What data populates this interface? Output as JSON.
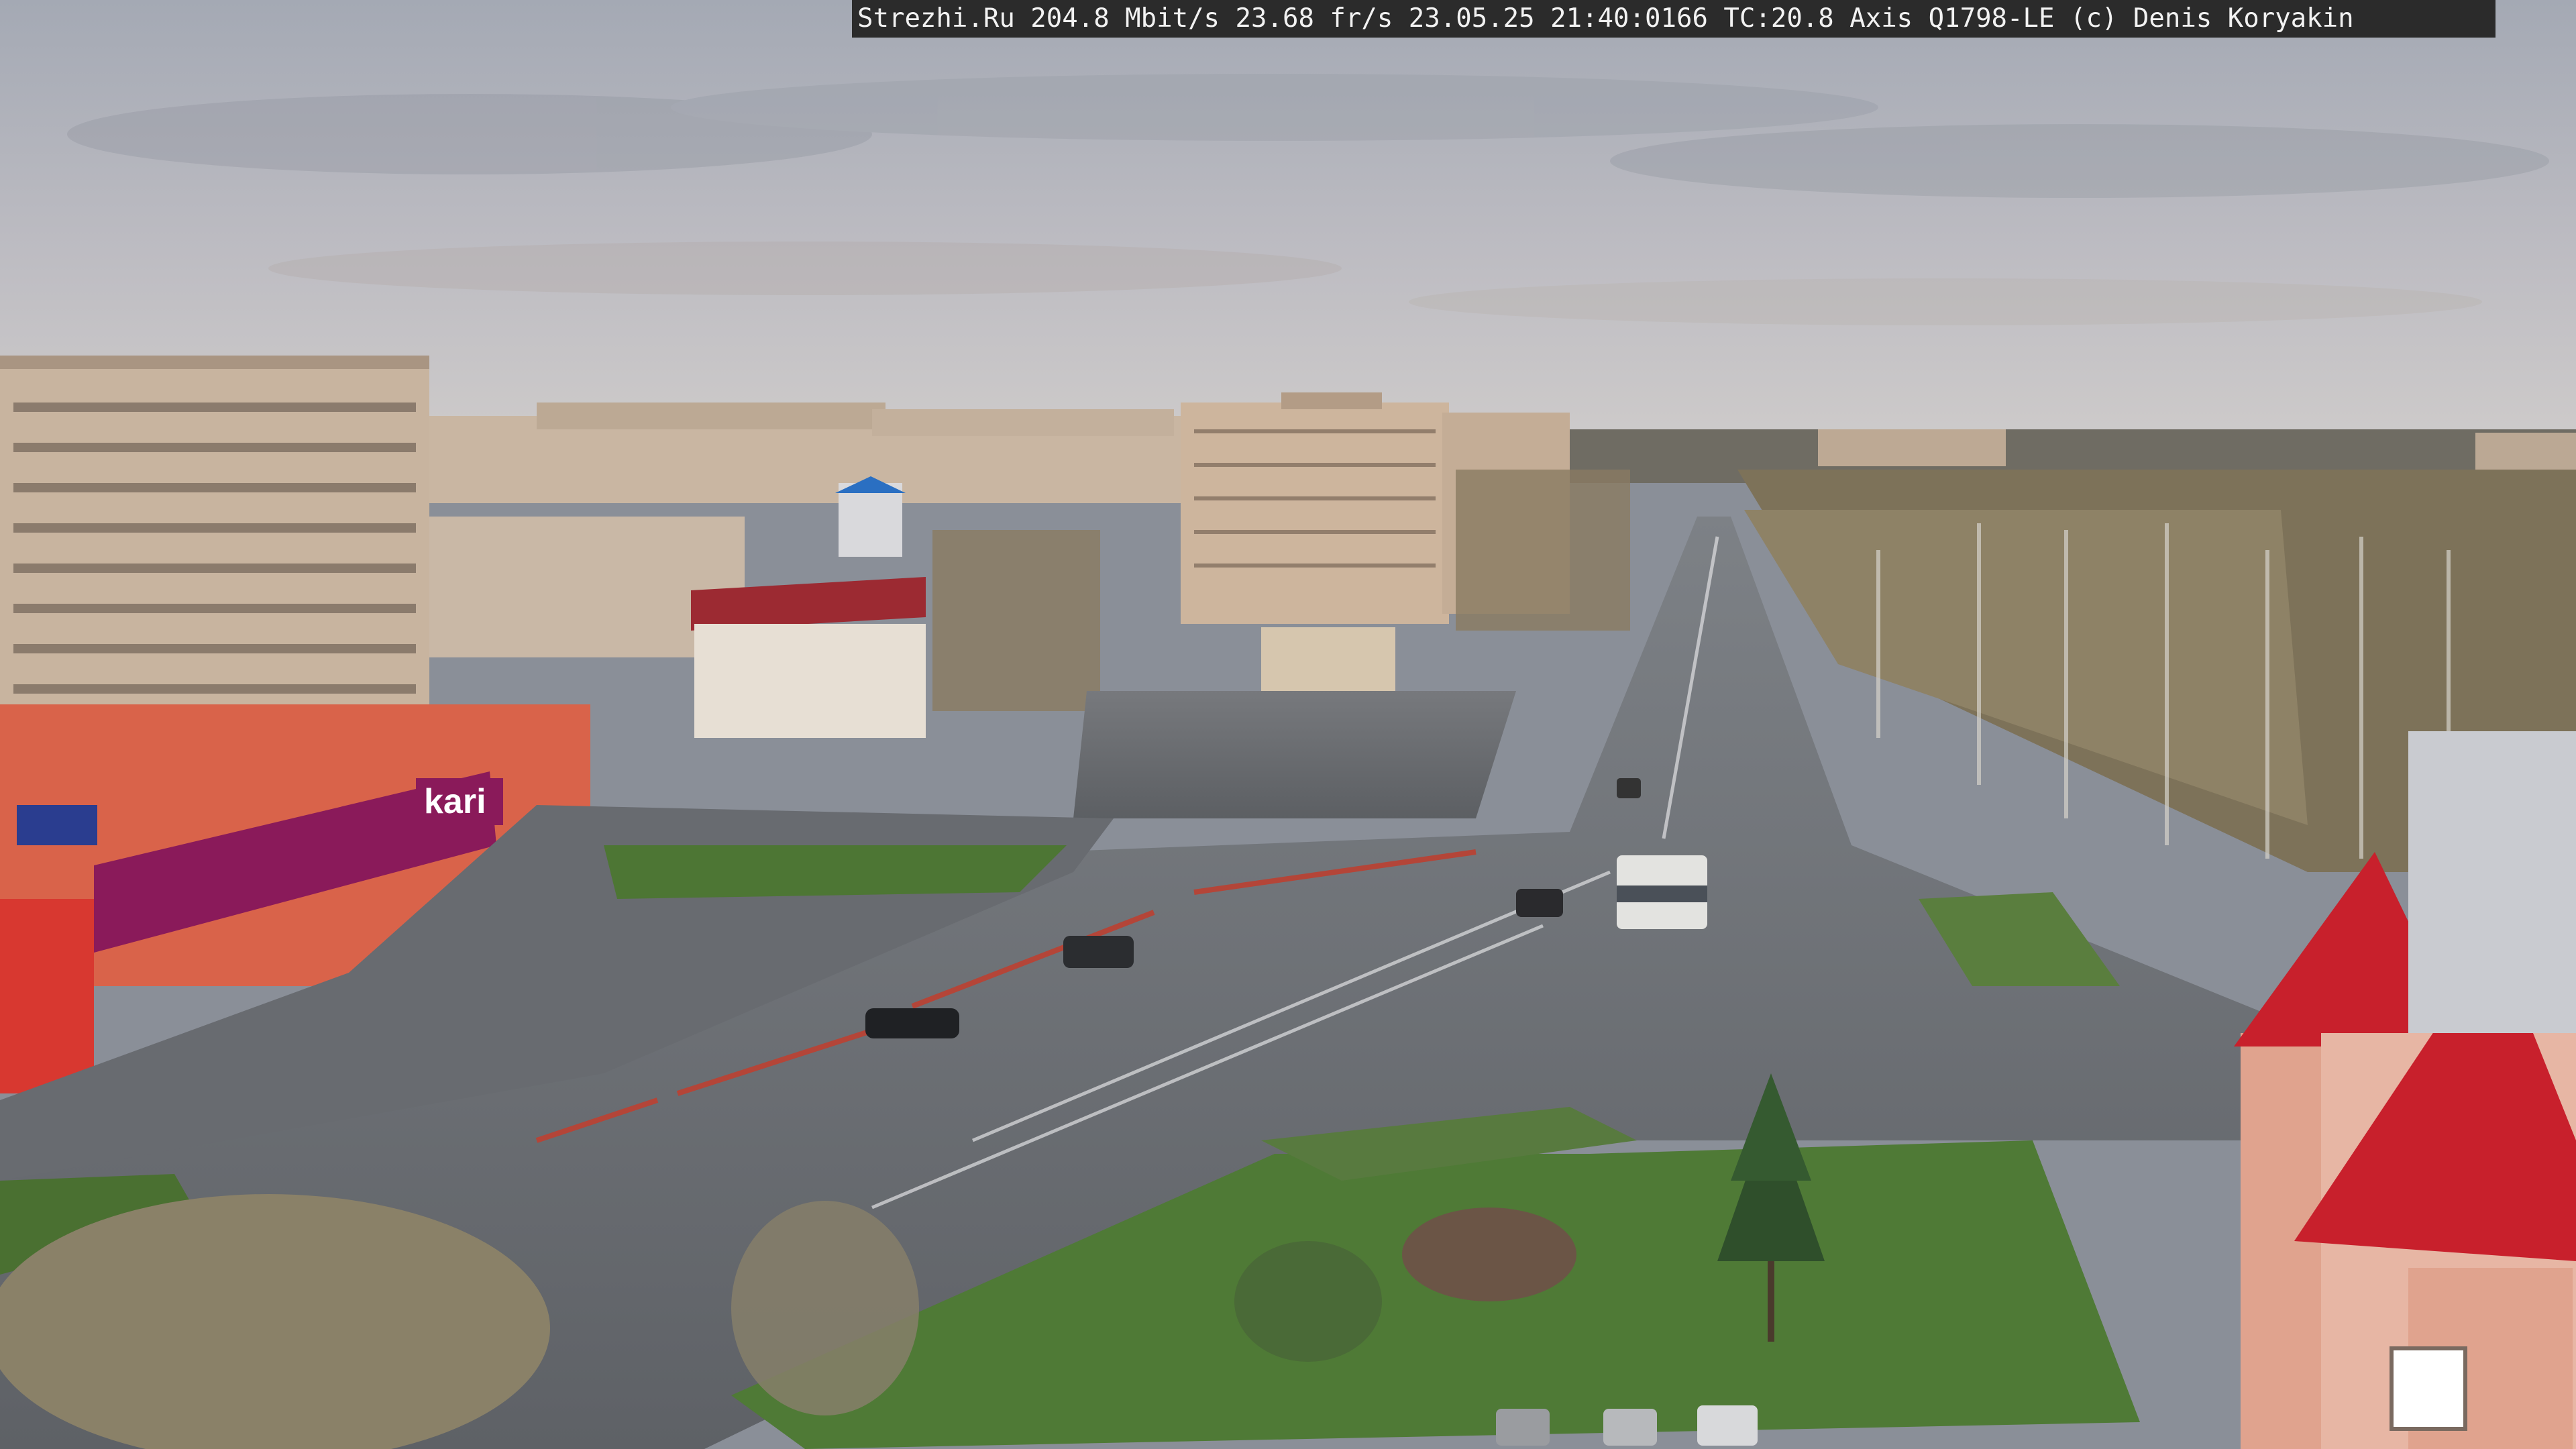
{
  "camera_overlay": {
    "text": "Strezhi.Ru 204.8 Mbit/s 23.68 fr/s 23.05.25 21:40:0166 TC:20.8  Axis Q1798-LE  (c) Denis Koryakin"
  },
  "storefront": {
    "brand": "kari"
  },
  "colors": {
    "sky_top": "#a9aeb8",
    "sky_bottom": "#c9c6c6",
    "asphalt": "#6b6e72",
    "grass": "#4f7a36",
    "brick": "#d8c3ad",
    "red_roof": "#c8202c",
    "kari_magenta": "#8a1a5a"
  }
}
